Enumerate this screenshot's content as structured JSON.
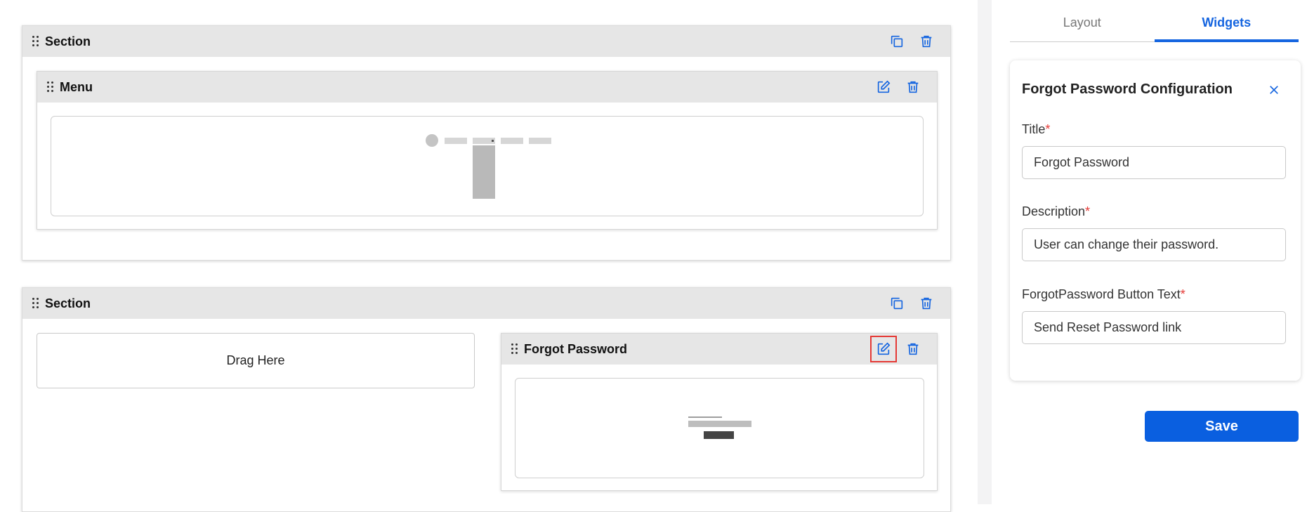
{
  "sections": [
    {
      "label": "Section"
    },
    {
      "label": "Section"
    }
  ],
  "menu_widget": {
    "label": "Menu"
  },
  "drop_zone": {
    "label": "Drag Here"
  },
  "forgot_widget": {
    "label": "Forgot Password"
  },
  "icons": {
    "copy": "copy-icon",
    "delete": "trash-icon",
    "edit": "edit-icon",
    "close": "close-icon",
    "grip": "drag-handle-icon"
  },
  "panel": {
    "tabs": [
      {
        "label": "Layout",
        "active": false
      },
      {
        "label": "Widgets",
        "active": true
      }
    ],
    "config": {
      "title": "Forgot Password Configuration",
      "fields": [
        {
          "label": "Title",
          "required_mark": "*",
          "value": "Forgot Password"
        },
        {
          "label": "Description",
          "required_mark": "*",
          "value": "User can change their password."
        },
        {
          "label": "ForgotPassword Button Text",
          "required_mark": "*",
          "value": "Send Reset Password link"
        }
      ]
    },
    "save_label": "Save"
  },
  "colors": {
    "accent": "#0a5fe0",
    "tab_active": "#1565e0",
    "required": "#e53935",
    "highlight": "#e53935",
    "bar_bg": "#e6e6e6"
  }
}
